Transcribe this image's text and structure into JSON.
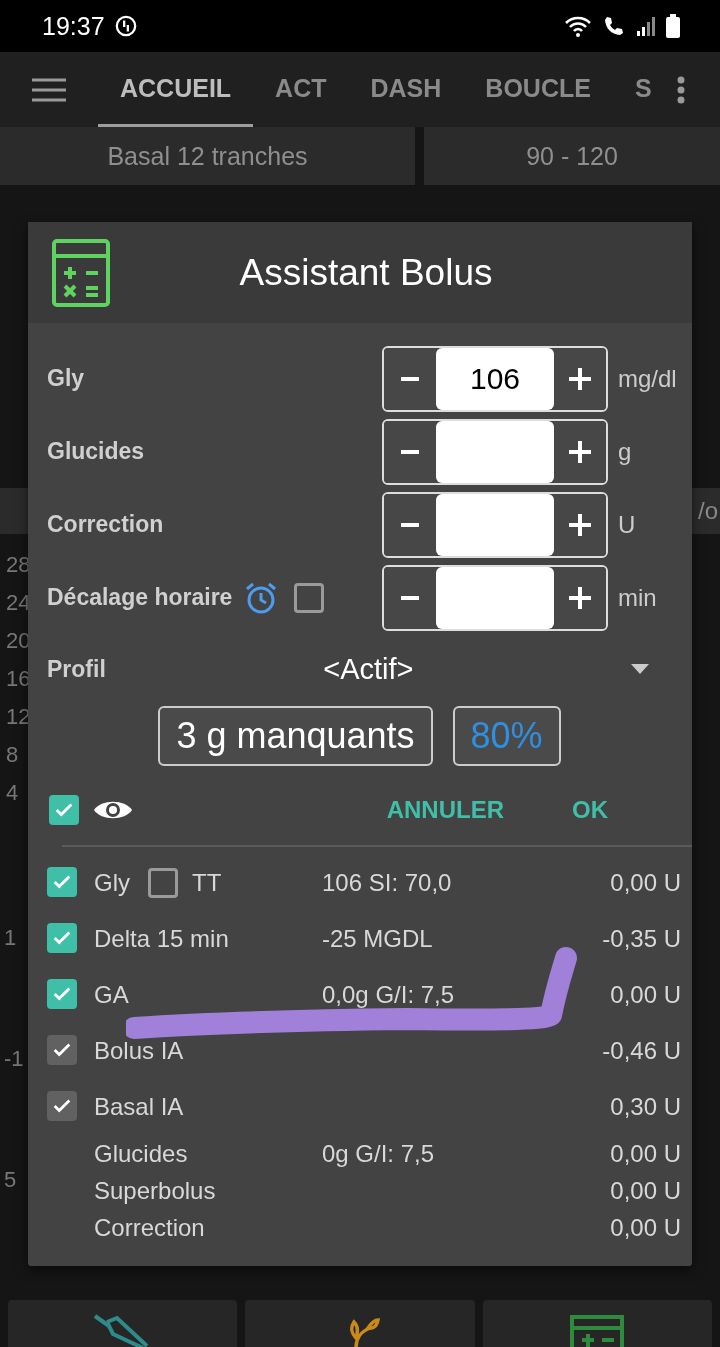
{
  "status_bar": {
    "time": "19:37"
  },
  "tabs": [
    {
      "label": "ACCUEIL",
      "selected": true
    },
    {
      "label": "ACT",
      "selected": false
    },
    {
      "label": "DASH",
      "selected": false
    },
    {
      "label": "BOUCLE",
      "selected": false
    },
    {
      "label": "S",
      "selected": false
    }
  ],
  "profile_bar": [
    "Basal 12 tranches",
    "90 - 120"
  ],
  "background": {
    "axis_labels": [
      "28",
      "24",
      "20",
      "16",
      "12",
      "8",
      "4"
    ],
    "lower_labels": [
      "1",
      "-1",
      "5"
    ],
    "right_text": "/o"
  },
  "dialog": {
    "title": "Assistant Bolus",
    "inputs": [
      {
        "kind": "plain",
        "label": "Gly",
        "value": "106",
        "unit": "mg/dl"
      },
      {
        "kind": "plain",
        "label": "Glucides",
        "unit": "g"
      },
      {
        "kind": "plain",
        "label": "Correction",
        "unit": "U"
      },
      {
        "kind": "timed",
        "label": "Décalage horaire",
        "unit": "min",
        "checked": false
      }
    ],
    "profile": {
      "label": "Profil",
      "value": "<Actif>"
    },
    "missing": "3 g manquants",
    "percent": "80%",
    "show_details": {
      "checked": true
    },
    "actions": [
      "ANNULER",
      "OK"
    ],
    "rows": [
      {
        "kind": "check",
        "checked": true,
        "disabled": false,
        "label": "Gly",
        "tt": {
          "label": "TT",
          "checked": false
        },
        "detail": "106 SI: 70,0",
        "amount": "0,00 U"
      },
      {
        "kind": "check",
        "checked": true,
        "disabled": false,
        "label": "Delta 15 min",
        "detail": "-25 MGDL",
        "amount": "-0,35 U"
      },
      {
        "kind": "check",
        "checked": true,
        "disabled": false,
        "label": "GA",
        "detail": "0,0g G/I: 7,5",
        "amount": "0,00 U"
      },
      {
        "kind": "check",
        "checked": true,
        "disabled": true,
        "label": "Bolus IA",
        "amount": "-0,46 U"
      },
      {
        "kind": "check",
        "checked": true,
        "disabled": true,
        "label": "Basal IA",
        "amount": "0,30 U"
      },
      {
        "kind": "plain",
        "label": "Glucides",
        "detail": "0g G/I: 7,5",
        "amount": "0,00 U"
      },
      {
        "kind": "plain",
        "label": "Superbolus",
        "amount": "0,00 U"
      },
      {
        "kind": "plain",
        "label": "Correction",
        "amount": "0,00 U"
      }
    ]
  }
}
